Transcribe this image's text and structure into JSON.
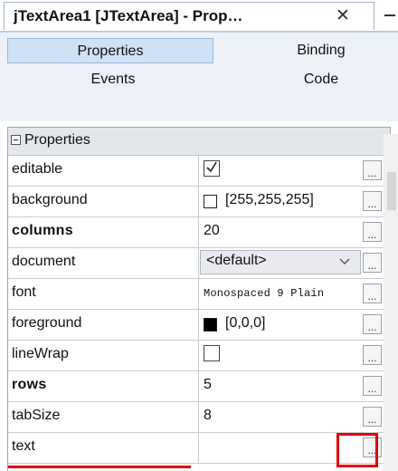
{
  "window": {
    "title": "jTextArea1 [JTextArea] - Prop…",
    "close_glyph": "✕"
  },
  "tabs": [
    {
      "label": "Properties",
      "selected": true
    },
    {
      "label": "Binding",
      "selected": false
    },
    {
      "label": "Events",
      "selected": false
    },
    {
      "label": "Code",
      "selected": false
    }
  ],
  "section": {
    "label": "Properties",
    "collapse_icon": "minus-box-icon"
  },
  "properties": [
    {
      "name": "editable",
      "bold": false,
      "kind": "checkbox",
      "checked": true
    },
    {
      "name": "background",
      "bold": false,
      "kind": "color",
      "color": "#ffffff",
      "value": "[255,255,255]"
    },
    {
      "name": "columns",
      "bold": true,
      "kind": "text",
      "value": "20"
    },
    {
      "name": "document",
      "bold": false,
      "kind": "combo",
      "value": "<default>"
    },
    {
      "name": "font",
      "bold": false,
      "kind": "mono",
      "value": "Monospaced 9 Plain"
    },
    {
      "name": "foreground",
      "bold": false,
      "kind": "color",
      "color": "#000000",
      "value": "[0,0,0]"
    },
    {
      "name": "lineWrap",
      "bold": false,
      "kind": "checkbox",
      "checked": false
    },
    {
      "name": "rows",
      "bold": true,
      "kind": "text",
      "value": "5"
    },
    {
      "name": "tabSize",
      "bold": false,
      "kind": "text",
      "value": "8"
    },
    {
      "name": "text",
      "bold": false,
      "kind": "text",
      "value": ""
    }
  ],
  "ellipsis_label": "...",
  "colors": {
    "highlight": "#e50000",
    "selected_tab": "#cfe1f5"
  }
}
